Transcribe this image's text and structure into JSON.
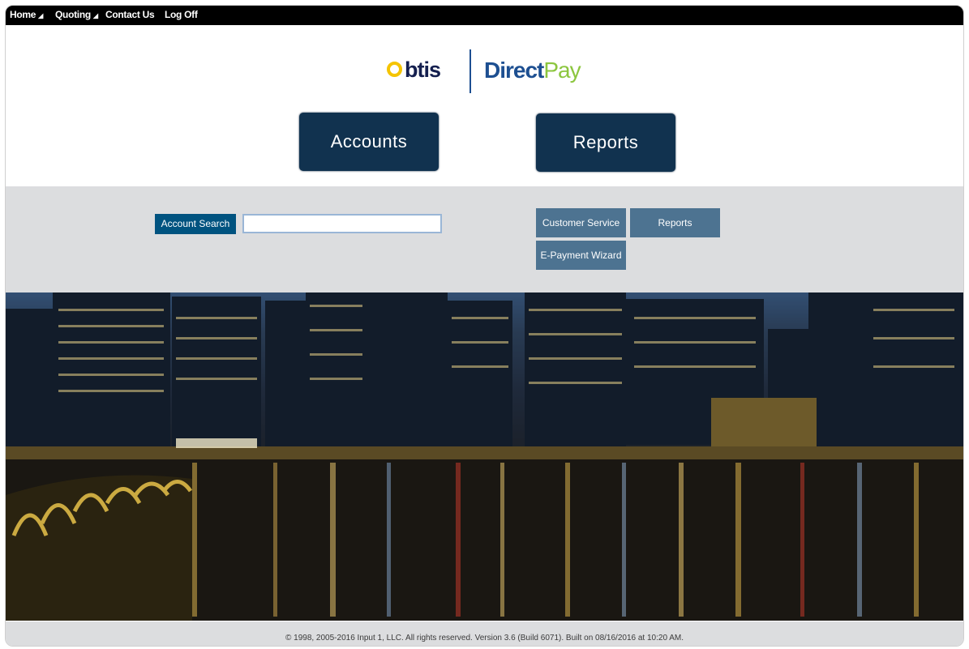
{
  "nav": {
    "items": [
      {
        "label": "Home",
        "has_dropdown": true
      },
      {
        "label": "Quoting",
        "has_dropdown": true
      },
      {
        "label": "Contact Us",
        "has_dropdown": false
      },
      {
        "label": "Log Off",
        "has_dropdown": false
      }
    ],
    "dropdown_glyph": "◢"
  },
  "logo": {
    "brand1": "btis",
    "brand2_a": "Direct",
    "brand2_b": "Pay",
    "colors": {
      "btis_ring": "#f5c400",
      "btis_text": "#141f4f",
      "direct": "#1d4f91",
      "pay": "#8cc63f"
    }
  },
  "main_buttons": {
    "accounts": "Accounts",
    "reports": "Reports",
    "color": "#11324f"
  },
  "search": {
    "label": "Account Search",
    "value": "",
    "placeholder": ""
  },
  "quick_links": {
    "customer_service": "Customer Service",
    "reports": "Reports",
    "epayment": "E-Payment Wizard",
    "color": "#4d7391"
  },
  "hero_image": {
    "description": "city-skyline-at-night"
  },
  "footer": {
    "text": "© 1998, 2005-2016 Input 1, LLC. All rights reserved. Version 3.6 (Build 6071). Built on 08/16/2016 at 10:20 AM."
  }
}
